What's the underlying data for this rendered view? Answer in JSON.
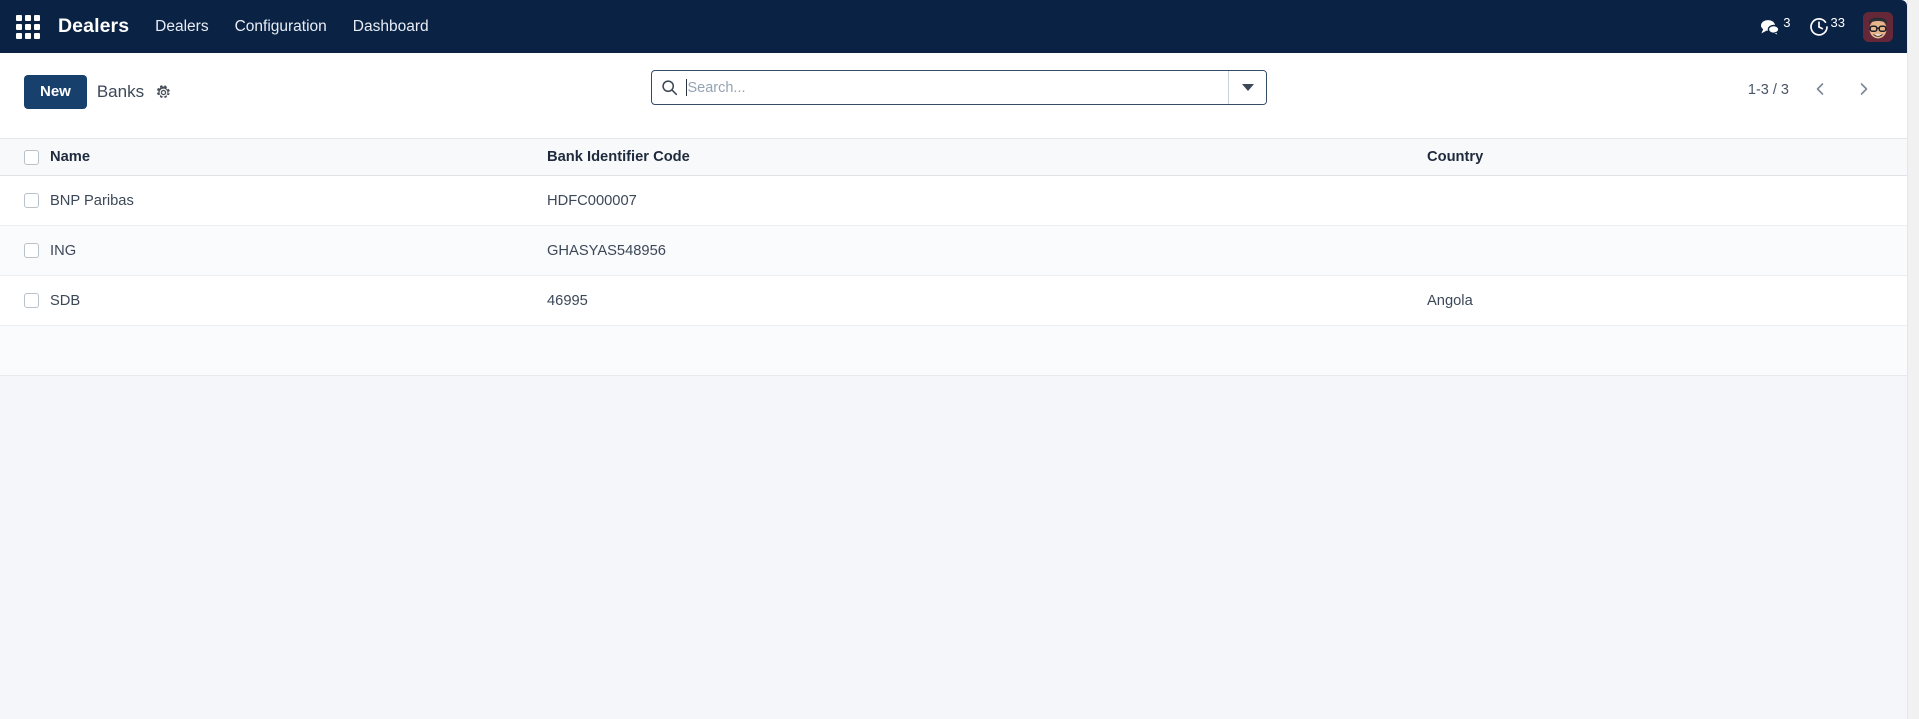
{
  "navbar": {
    "apps_icon": "apps-grid-icon",
    "brand": "Dealers",
    "menu": [
      {
        "label": "Dealers"
      },
      {
        "label": "Configuration"
      },
      {
        "label": "Dashboard"
      }
    ],
    "messages_icon": "message-bubble-icon",
    "messages_count": "3",
    "activities_icon": "clock-icon",
    "activities_count": "33",
    "avatar_icon": "user-avatar",
    "background_color": "#0a2244"
  },
  "control_panel": {
    "new_button": "New",
    "title": "Banks",
    "gear_icon": "gear-icon",
    "search": {
      "icon": "search-icon",
      "value": "",
      "placeholder": "Search...",
      "toggle_icon": "chevron-down-icon"
    },
    "pager": {
      "range": "1-3 / 3",
      "prev_icon": "chevron-left-icon",
      "next_icon": "chevron-right-icon"
    },
    "new_button_color": "#17406d"
  },
  "table": {
    "columns": [
      {
        "key": "name",
        "label": "Name"
      },
      {
        "key": "bic",
        "label": "Bank Identifier Code"
      },
      {
        "key": "country",
        "label": "Country"
      }
    ],
    "rows": [
      {
        "name": "BNP Paribas",
        "bic": "HDFC000007",
        "country": ""
      },
      {
        "name": "ING",
        "bic": "GHASYAS548956",
        "country": ""
      },
      {
        "name": "SDB",
        "bic": "46995",
        "country": "Angola"
      }
    ]
  }
}
